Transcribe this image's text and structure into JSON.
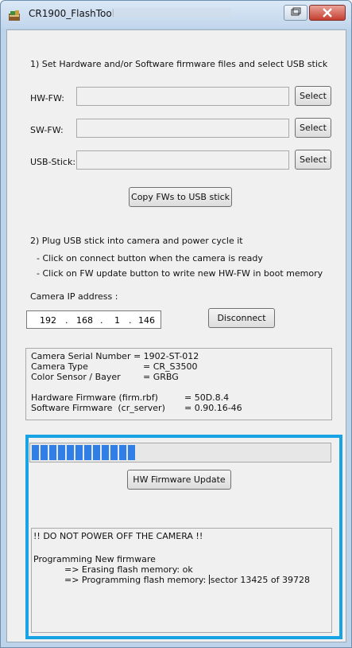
{
  "window": {
    "title": "CR1900_FlashTool"
  },
  "step1": {
    "instruction": "1) Set Hardware and/or Software firmware files and select USB stick",
    "hw_label": "HW-FW:",
    "hw_value": "",
    "sw_label": "SW-FW:",
    "sw_value": "",
    "usb_label": "USB-Stick:",
    "usb_value": "",
    "select_label": "Select",
    "copy_button": "Copy FWs to USB stick"
  },
  "step2": {
    "instruction": "2) Plug USB stick into camera and power cycle it",
    "hint1": "- Click on connect button when the camera is ready",
    "hint2": "- Click on FW update button to write new HW-FW in boot memory",
    "ip_label": "Camera IP address :",
    "ip": [
      "192",
      "168",
      "1",
      "146"
    ],
    "disconnect_button": "Disconnect"
  },
  "camera_info": {
    "serial": "Camera Serial Number = 1902-ST-012",
    "type_label": "Camera Type",
    "type_value": "= CR_S3500",
    "sensor_label": "Color Sensor / Bayer",
    "sensor_value": "= GRBG",
    "hw_fw_label": "Hardware Firmware (firm.rbf)",
    "hw_fw_value": "= 50D.8.4",
    "sw_fw_label": "Software Firmware  (cr_server)",
    "sw_fw_value": "= 0.90.16-46"
  },
  "update": {
    "progress_fraction": 0.34,
    "hw_update_button": "HW Firmware Update",
    "log_warning": "!! DO NOT POWER OFF THE CAMERA !!",
    "log_line1": "Programming New firmware",
    "log_line2": "=> Erasing flash memory: ok",
    "log_line3a": "=> Programming flash memory: ",
    "log_line3b": "sector 13425 of 39728"
  },
  "colors": {
    "highlight_border": "#17a3e4",
    "progress_fill": "#2f7fe6",
    "close_button": "#c63f2f"
  }
}
